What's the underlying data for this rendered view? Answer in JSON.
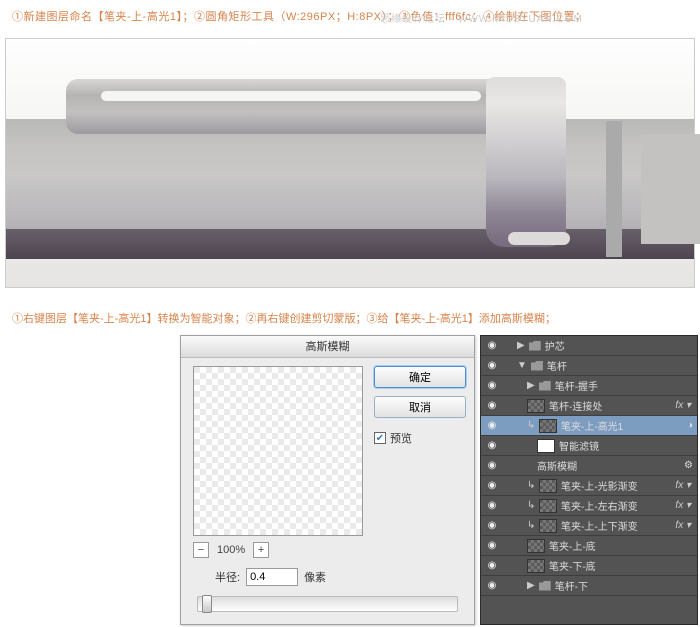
{
  "watermark": "思缘设计论坛 · WWW.MISSYUAN.COM",
  "step1": "①新建图层命名【笔夹-上-高光1】；②圆角矩形工具（W:296PX；H:8PX）；③色值：fff6fc；④绘制在下图位置；",
  "step2": "①右键图层【笔夹-上-高光1】转换为智能对象；②再右键创建剪切蒙版；③给【笔夹-上-高光1】添加高斯模糊；",
  "dialog": {
    "title": "高斯模糊",
    "ok": "确定",
    "cancel": "取消",
    "preview": "预览",
    "zoom": "100%",
    "radius_label": "半径:",
    "radius_value": "0.4",
    "radius_unit": "像素"
  },
  "layers": [
    {
      "eye": "◉",
      "indent": 1,
      "folder": true,
      "tri": "▶",
      "name": "护芯"
    },
    {
      "eye": "◉",
      "indent": 1,
      "folder": true,
      "tri": "▼",
      "open": true,
      "name": "笔杆"
    },
    {
      "eye": "◉",
      "indent": 2,
      "folder": true,
      "tri": "▶",
      "name": "笔杆-握手"
    },
    {
      "eye": "◉",
      "indent": 2,
      "thumb": true,
      "name": "笔杆-连接处",
      "fx": "fx ▾"
    },
    {
      "eye": "◉",
      "indent": 2,
      "clip": "↳",
      "thumb": true,
      "name": "笔夹-上-高光1",
      "sel": true,
      "smart": "◑"
    },
    {
      "eye": "◉",
      "indent": 3,
      "white": true,
      "name": "智能滤镜"
    },
    {
      "eye": "◉",
      "indent": 3,
      "name": "高斯模糊",
      "edit": "⚙"
    },
    {
      "eye": "◉",
      "indent": 2,
      "clip": "↳",
      "thumb": true,
      "name": "笔夹-上-光影渐变",
      "fx": "fx ▾"
    },
    {
      "eye": "◉",
      "indent": 2,
      "clip": "↳",
      "thumb": true,
      "name": "笔夹-上-左右渐变",
      "fx": "fx ▾"
    },
    {
      "eye": "◉",
      "indent": 2,
      "clip": "↳",
      "thumb": true,
      "name": "笔夹-上-上下渐变",
      "fx": "fx ▾"
    },
    {
      "eye": "◉",
      "indent": 2,
      "thumb": true,
      "name": "笔夹-上-底"
    },
    {
      "eye": "◉",
      "indent": 2,
      "thumb": true,
      "name": "笔夹-下-底"
    },
    {
      "eye": "◉",
      "indent": 2,
      "folder": true,
      "tri": "▶",
      "name": "笔杆-下"
    }
  ]
}
